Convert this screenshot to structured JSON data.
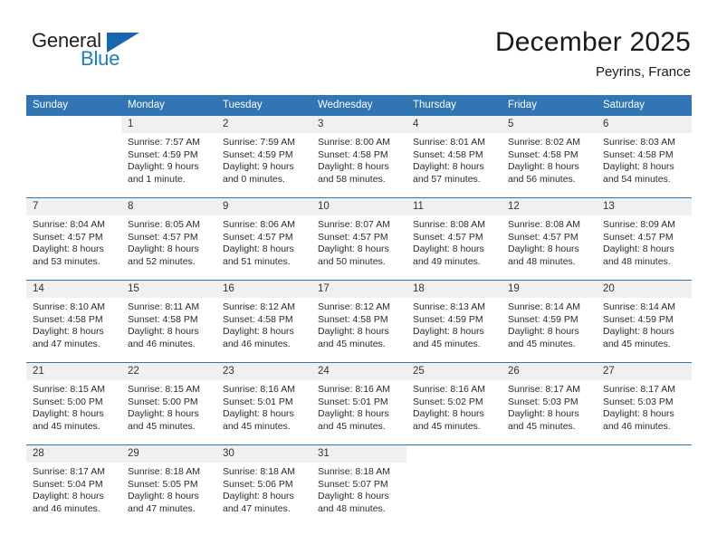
{
  "logo": {
    "text_primary": "General",
    "text_secondary": "Blue",
    "triangle_color": "#1667ad",
    "primary_color": "#231f20",
    "secondary_color": "#1d7dc0"
  },
  "header": {
    "month_title": "December 2025",
    "location": "Peyrins, France",
    "accent_color": "#3175b4"
  },
  "calendar": {
    "weekday_headers": [
      "Sunday",
      "Monday",
      "Tuesday",
      "Wednesday",
      "Thursday",
      "Friday",
      "Saturday"
    ],
    "weeks": [
      [
        {
          "day": "",
          "lines": []
        },
        {
          "day": "1",
          "lines": [
            "Sunrise: 7:57 AM",
            "Sunset: 4:59 PM",
            "Daylight: 9 hours",
            "and 1 minute."
          ]
        },
        {
          "day": "2",
          "lines": [
            "Sunrise: 7:59 AM",
            "Sunset: 4:59 PM",
            "Daylight: 9 hours",
            "and 0 minutes."
          ]
        },
        {
          "day": "3",
          "lines": [
            "Sunrise: 8:00 AM",
            "Sunset: 4:58 PM",
            "Daylight: 8 hours",
            "and 58 minutes."
          ]
        },
        {
          "day": "4",
          "lines": [
            "Sunrise: 8:01 AM",
            "Sunset: 4:58 PM",
            "Daylight: 8 hours",
            "and 57 minutes."
          ]
        },
        {
          "day": "5",
          "lines": [
            "Sunrise: 8:02 AM",
            "Sunset: 4:58 PM",
            "Daylight: 8 hours",
            "and 56 minutes."
          ]
        },
        {
          "day": "6",
          "lines": [
            "Sunrise: 8:03 AM",
            "Sunset: 4:58 PM",
            "Daylight: 8 hours",
            "and 54 minutes."
          ]
        }
      ],
      [
        {
          "day": "7",
          "lines": [
            "Sunrise: 8:04 AM",
            "Sunset: 4:57 PM",
            "Daylight: 8 hours",
            "and 53 minutes."
          ]
        },
        {
          "day": "8",
          "lines": [
            "Sunrise: 8:05 AM",
            "Sunset: 4:57 PM",
            "Daylight: 8 hours",
            "and 52 minutes."
          ]
        },
        {
          "day": "9",
          "lines": [
            "Sunrise: 8:06 AM",
            "Sunset: 4:57 PM",
            "Daylight: 8 hours",
            "and 51 minutes."
          ]
        },
        {
          "day": "10",
          "lines": [
            "Sunrise: 8:07 AM",
            "Sunset: 4:57 PM",
            "Daylight: 8 hours",
            "and 50 minutes."
          ]
        },
        {
          "day": "11",
          "lines": [
            "Sunrise: 8:08 AM",
            "Sunset: 4:57 PM",
            "Daylight: 8 hours",
            "and 49 minutes."
          ]
        },
        {
          "day": "12",
          "lines": [
            "Sunrise: 8:08 AM",
            "Sunset: 4:57 PM",
            "Daylight: 8 hours",
            "and 48 minutes."
          ]
        },
        {
          "day": "13",
          "lines": [
            "Sunrise: 8:09 AM",
            "Sunset: 4:57 PM",
            "Daylight: 8 hours",
            "and 48 minutes."
          ]
        }
      ],
      [
        {
          "day": "14",
          "lines": [
            "Sunrise: 8:10 AM",
            "Sunset: 4:58 PM",
            "Daylight: 8 hours",
            "and 47 minutes."
          ]
        },
        {
          "day": "15",
          "lines": [
            "Sunrise: 8:11 AM",
            "Sunset: 4:58 PM",
            "Daylight: 8 hours",
            "and 46 minutes."
          ]
        },
        {
          "day": "16",
          "lines": [
            "Sunrise: 8:12 AM",
            "Sunset: 4:58 PM",
            "Daylight: 8 hours",
            "and 46 minutes."
          ]
        },
        {
          "day": "17",
          "lines": [
            "Sunrise: 8:12 AM",
            "Sunset: 4:58 PM",
            "Daylight: 8 hours",
            "and 45 minutes."
          ]
        },
        {
          "day": "18",
          "lines": [
            "Sunrise: 8:13 AM",
            "Sunset: 4:59 PM",
            "Daylight: 8 hours",
            "and 45 minutes."
          ]
        },
        {
          "day": "19",
          "lines": [
            "Sunrise: 8:14 AM",
            "Sunset: 4:59 PM",
            "Daylight: 8 hours",
            "and 45 minutes."
          ]
        },
        {
          "day": "20",
          "lines": [
            "Sunrise: 8:14 AM",
            "Sunset: 4:59 PM",
            "Daylight: 8 hours",
            "and 45 minutes."
          ]
        }
      ],
      [
        {
          "day": "21",
          "lines": [
            "Sunrise: 8:15 AM",
            "Sunset: 5:00 PM",
            "Daylight: 8 hours",
            "and 45 minutes."
          ]
        },
        {
          "day": "22",
          "lines": [
            "Sunrise: 8:15 AM",
            "Sunset: 5:00 PM",
            "Daylight: 8 hours",
            "and 45 minutes."
          ]
        },
        {
          "day": "23",
          "lines": [
            "Sunrise: 8:16 AM",
            "Sunset: 5:01 PM",
            "Daylight: 8 hours",
            "and 45 minutes."
          ]
        },
        {
          "day": "24",
          "lines": [
            "Sunrise: 8:16 AM",
            "Sunset: 5:01 PM",
            "Daylight: 8 hours",
            "and 45 minutes."
          ]
        },
        {
          "day": "25",
          "lines": [
            "Sunrise: 8:16 AM",
            "Sunset: 5:02 PM",
            "Daylight: 8 hours",
            "and 45 minutes."
          ]
        },
        {
          "day": "26",
          "lines": [
            "Sunrise: 8:17 AM",
            "Sunset: 5:03 PM",
            "Daylight: 8 hours",
            "and 45 minutes."
          ]
        },
        {
          "day": "27",
          "lines": [
            "Sunrise: 8:17 AM",
            "Sunset: 5:03 PM",
            "Daylight: 8 hours",
            "and 46 minutes."
          ]
        }
      ],
      [
        {
          "day": "28",
          "lines": [
            "Sunrise: 8:17 AM",
            "Sunset: 5:04 PM",
            "Daylight: 8 hours",
            "and 46 minutes."
          ]
        },
        {
          "day": "29",
          "lines": [
            "Sunrise: 8:18 AM",
            "Sunset: 5:05 PM",
            "Daylight: 8 hours",
            "and 47 minutes."
          ]
        },
        {
          "day": "30",
          "lines": [
            "Sunrise: 8:18 AM",
            "Sunset: 5:06 PM",
            "Daylight: 8 hours",
            "and 47 minutes."
          ]
        },
        {
          "day": "31",
          "lines": [
            "Sunrise: 8:18 AM",
            "Sunset: 5:07 PM",
            "Daylight: 8 hours",
            "and 48 minutes."
          ]
        },
        {
          "day": "",
          "lines": []
        },
        {
          "day": "",
          "lines": []
        },
        {
          "day": "",
          "lines": []
        }
      ]
    ]
  }
}
